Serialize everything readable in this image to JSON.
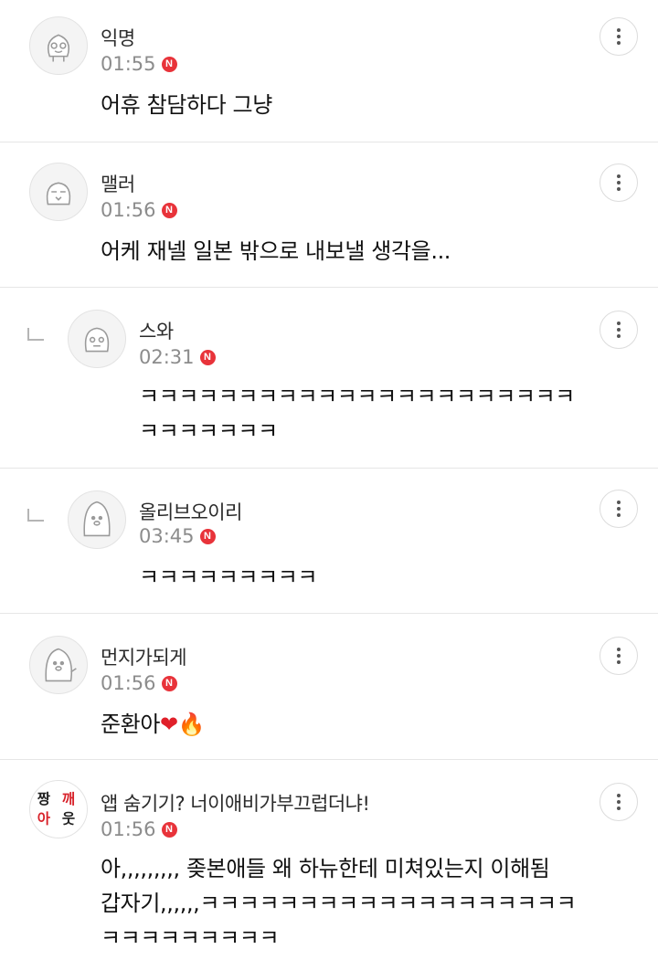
{
  "comments": [
    {
      "author": "익명",
      "time": "01:55",
      "badge": "N",
      "lines": [
        "어휴 참담하다 그냥"
      ]
    },
    {
      "author": "맬러",
      "time": "01:56",
      "badge": "N",
      "lines": [
        "어케 재넬 일본 밖으로 내보낼 생각을..."
      ]
    },
    {
      "author": "스와",
      "time": "02:31",
      "badge": "N",
      "lines": [
        "ㅋㅋㅋㅋㅋㅋㅋㅋㅋㅋㅋㅋㅋㅋㅋㅋㅋㅋㅋㅋㅋㅋ",
        "ㅋㅋㅋㅋㅋㅋㅋ"
      ]
    },
    {
      "author": "올리브오이리",
      "time": "03:45",
      "badge": "N",
      "lines": [
        "ㅋㅋㅋㅋㅋㅋㅋㅋㅋ"
      ]
    },
    {
      "author": "먼지가되게",
      "time": "01:56",
      "badge": "N",
      "text": "준환아",
      "emoji_heart": "❤",
      "emoji_fire": "🔥"
    },
    {
      "author": "앱 숨기기? 너이애비가부끄럽더냐!",
      "time": "01:56",
      "badge": "N",
      "avatar_text": [
        "짱",
        "깨",
        "아",
        "웃"
      ],
      "lines": [
        "아,,,,,,,,, 좆본애들 왜 하뉴한테 미쳐있는지 이해됨",
        "갑자기,,,,,,ㅋㅋㅋㅋㅋㅋㅋㅋㅋㅋㅋㅋㅋㅋㅋㅋㅋㅋㅋ",
        "ㅋㅋㅋㅋㅋㅋㅋㅋㅋ"
      ]
    }
  ],
  "colors": {
    "badge": "#e8333a",
    "divider": "#e6e6e6",
    "time": "#8c8c8c"
  }
}
